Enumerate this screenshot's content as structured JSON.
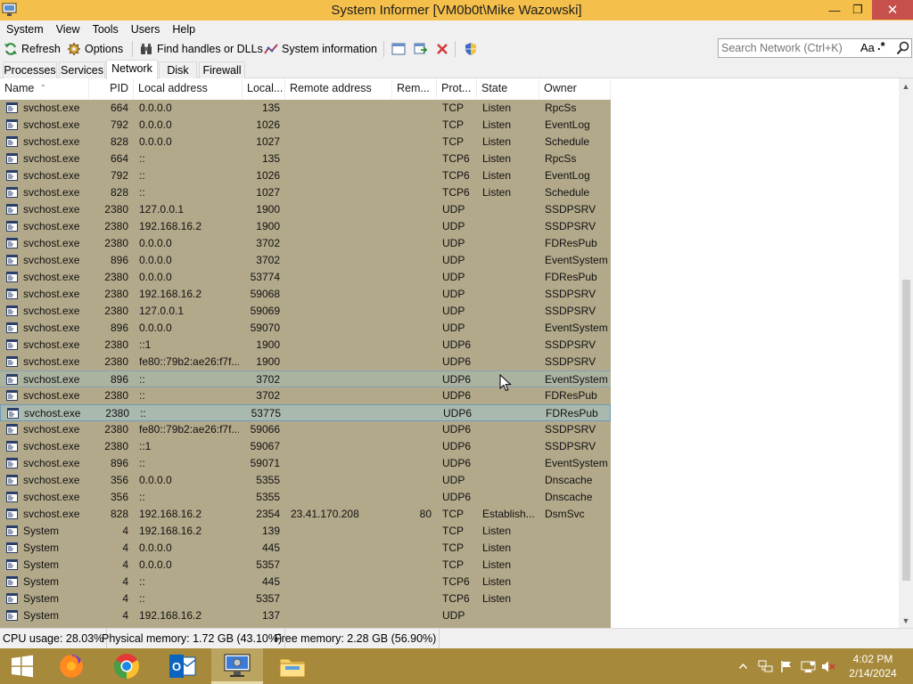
{
  "window": {
    "title": "System Informer [VM0b0t\\Mike Wazowski]",
    "min_icon": "minimize-icon",
    "max_icon": "restore-icon",
    "close_icon": "close-icon"
  },
  "menu": [
    "System",
    "View",
    "Tools",
    "Users",
    "Help"
  ],
  "toolbar": {
    "refresh": "Refresh",
    "options": "Options",
    "find_handles": "Find handles or DLLs",
    "system_information": "System information"
  },
  "search": {
    "placeholder": "Search Network (Ctrl+K)",
    "case_label": "Aa",
    "regex_label": ".*"
  },
  "tabs": [
    {
      "label": "Processes",
      "active": false
    },
    {
      "label": "Services",
      "active": false
    },
    {
      "label": "Network",
      "active": true
    },
    {
      "label": "Disk",
      "active": false
    },
    {
      "label": "Firewall",
      "active": false
    }
  ],
  "columns": [
    "Name",
    "PID",
    "Local address",
    "Local...",
    "Remote address",
    "Rem...",
    "Prot...",
    "State",
    "Owner"
  ],
  "rows": [
    {
      "name": "svchost.exe",
      "pid": "664",
      "local_address": "0.0.0.0",
      "local_port": "135",
      "remote_address": "",
      "remote_port": "",
      "protocol": "TCP",
      "state": "Listen",
      "owner": "RpcSs"
    },
    {
      "name": "svchost.exe",
      "pid": "792",
      "local_address": "0.0.0.0",
      "local_port": "1026",
      "remote_address": "",
      "remote_port": "",
      "protocol": "TCP",
      "state": "Listen",
      "owner": "EventLog"
    },
    {
      "name": "svchost.exe",
      "pid": "828",
      "local_address": "0.0.0.0",
      "local_port": "1027",
      "remote_address": "",
      "remote_port": "",
      "protocol": "TCP",
      "state": "Listen",
      "owner": "Schedule"
    },
    {
      "name": "svchost.exe",
      "pid": "664",
      "local_address": "::",
      "local_port": "135",
      "remote_address": "",
      "remote_port": "",
      "protocol": "TCP6",
      "state": "Listen",
      "owner": "RpcSs"
    },
    {
      "name": "svchost.exe",
      "pid": "792",
      "local_address": "::",
      "local_port": "1026",
      "remote_address": "",
      "remote_port": "",
      "protocol": "TCP6",
      "state": "Listen",
      "owner": "EventLog"
    },
    {
      "name": "svchost.exe",
      "pid": "828",
      "local_address": "::",
      "local_port": "1027",
      "remote_address": "",
      "remote_port": "",
      "protocol": "TCP6",
      "state": "Listen",
      "owner": "Schedule"
    },
    {
      "name": "svchost.exe",
      "pid": "2380",
      "local_address": "127.0.0.1",
      "local_port": "1900",
      "remote_address": "",
      "remote_port": "",
      "protocol": "UDP",
      "state": "",
      "owner": "SSDPSRV"
    },
    {
      "name": "svchost.exe",
      "pid": "2380",
      "local_address": "192.168.16.2",
      "local_port": "1900",
      "remote_address": "",
      "remote_port": "",
      "protocol": "UDP",
      "state": "",
      "owner": "SSDPSRV"
    },
    {
      "name": "svchost.exe",
      "pid": "2380",
      "local_address": "0.0.0.0",
      "local_port": "3702",
      "remote_address": "",
      "remote_port": "",
      "protocol": "UDP",
      "state": "",
      "owner": "FDResPub"
    },
    {
      "name": "svchost.exe",
      "pid": "896",
      "local_address": "0.0.0.0",
      "local_port": "3702",
      "remote_address": "",
      "remote_port": "",
      "protocol": "UDP",
      "state": "",
      "owner": "EventSystem"
    },
    {
      "name": "svchost.exe",
      "pid": "2380",
      "local_address": "0.0.0.0",
      "local_port": "53774",
      "remote_address": "",
      "remote_port": "",
      "protocol": "UDP",
      "state": "",
      "owner": "FDResPub"
    },
    {
      "name": "svchost.exe",
      "pid": "2380",
      "local_address": "192.168.16.2",
      "local_port": "59068",
      "remote_address": "",
      "remote_port": "",
      "protocol": "UDP",
      "state": "",
      "owner": "SSDPSRV"
    },
    {
      "name": "svchost.exe",
      "pid": "2380",
      "local_address": "127.0.0.1",
      "local_port": "59069",
      "remote_address": "",
      "remote_port": "",
      "protocol": "UDP",
      "state": "",
      "owner": "SSDPSRV"
    },
    {
      "name": "svchost.exe",
      "pid": "896",
      "local_address": "0.0.0.0",
      "local_port": "59070",
      "remote_address": "",
      "remote_port": "",
      "protocol": "UDP",
      "state": "",
      "owner": "EventSystem"
    },
    {
      "name": "svchost.exe",
      "pid": "2380",
      "local_address": "::1",
      "local_port": "1900",
      "remote_address": "",
      "remote_port": "",
      "protocol": "UDP6",
      "state": "",
      "owner": "SSDPSRV"
    },
    {
      "name": "svchost.exe",
      "pid": "2380",
      "local_address": "fe80::79b2:ae26:f7f...",
      "local_port": "1900",
      "remote_address": "",
      "remote_port": "",
      "protocol": "UDP6",
      "state": "",
      "owner": "SSDPSRV"
    },
    {
      "name": "svchost.exe",
      "pid": "896",
      "local_address": "::",
      "local_port": "3702",
      "remote_address": "",
      "remote_port": "",
      "protocol": "UDP6",
      "state": "",
      "owner": "EventSystem",
      "hover": true
    },
    {
      "name": "svchost.exe",
      "pid": "2380",
      "local_address": "::",
      "local_port": "3702",
      "remote_address": "",
      "remote_port": "",
      "protocol": "UDP6",
      "state": "",
      "owner": "FDResPub"
    },
    {
      "name": "svchost.exe",
      "pid": "2380",
      "local_address": "::",
      "local_port": "53775",
      "remote_address": "",
      "remote_port": "",
      "protocol": "UDP6",
      "state": "",
      "owner": "FDResPub",
      "selected": true
    },
    {
      "name": "svchost.exe",
      "pid": "2380",
      "local_address": "fe80::79b2:ae26:f7f...",
      "local_port": "59066",
      "remote_address": "",
      "remote_port": "",
      "protocol": "UDP6",
      "state": "",
      "owner": "SSDPSRV"
    },
    {
      "name": "svchost.exe",
      "pid": "2380",
      "local_address": "::1",
      "local_port": "59067",
      "remote_address": "",
      "remote_port": "",
      "protocol": "UDP6",
      "state": "",
      "owner": "SSDPSRV"
    },
    {
      "name": "svchost.exe",
      "pid": "896",
      "local_address": "::",
      "local_port": "59071",
      "remote_address": "",
      "remote_port": "",
      "protocol": "UDP6",
      "state": "",
      "owner": "EventSystem"
    },
    {
      "name": "svchost.exe",
      "pid": "356",
      "local_address": "0.0.0.0",
      "local_port": "5355",
      "remote_address": "",
      "remote_port": "",
      "protocol": "UDP",
      "state": "",
      "owner": "Dnscache"
    },
    {
      "name": "svchost.exe",
      "pid": "356",
      "local_address": "::",
      "local_port": "5355",
      "remote_address": "",
      "remote_port": "",
      "protocol": "UDP6",
      "state": "",
      "owner": "Dnscache"
    },
    {
      "name": "svchost.exe",
      "pid": "828",
      "local_address": "192.168.16.2",
      "local_port": "2354",
      "remote_address": "23.41.170.208",
      "remote_port": "80",
      "protocol": "TCP",
      "state": "Establish...",
      "owner": "DsmSvc"
    },
    {
      "name": "System",
      "pid": "4",
      "local_address": "192.168.16.2",
      "local_port": "139",
      "remote_address": "",
      "remote_port": "",
      "protocol": "TCP",
      "state": "Listen",
      "owner": ""
    },
    {
      "name": "System",
      "pid": "4",
      "local_address": "0.0.0.0",
      "local_port": "445",
      "remote_address": "",
      "remote_port": "",
      "protocol": "TCP",
      "state": "Listen",
      "owner": ""
    },
    {
      "name": "System",
      "pid": "4",
      "local_address": "0.0.0.0",
      "local_port": "5357",
      "remote_address": "",
      "remote_port": "",
      "protocol": "TCP",
      "state": "Listen",
      "owner": ""
    },
    {
      "name": "System",
      "pid": "4",
      "local_address": "::",
      "local_port": "445",
      "remote_address": "",
      "remote_port": "",
      "protocol": "TCP6",
      "state": "Listen",
      "owner": ""
    },
    {
      "name": "System",
      "pid": "4",
      "local_address": "::",
      "local_port": "5357",
      "remote_address": "",
      "remote_port": "",
      "protocol": "TCP6",
      "state": "Listen",
      "owner": ""
    },
    {
      "name": "System",
      "pid": "4",
      "local_address": "192.168.16.2",
      "local_port": "137",
      "remote_address": "",
      "remote_port": "",
      "protocol": "UDP",
      "state": "",
      "owner": ""
    }
  ],
  "status": {
    "cpu": "CPU usage: 28.03%",
    "physical": "Physical memory: 1.72 GB (43.10%)",
    "free": "Free memory: 2.28 GB (56.90%)"
  },
  "taskbar": {
    "apps": [
      "firefox-icon",
      "chrome-icon",
      "outlook-icon",
      "system-informer-icon",
      "file-explorer-icon"
    ],
    "tray": [
      "show-hidden-icons-chevron",
      "network-icon",
      "flag-icon",
      "action-center-icon",
      "volume-muted-icon"
    ],
    "time": "4:02 PM",
    "date": "2/14/2024"
  },
  "colors": {
    "title_bar": "#f4bf4a",
    "rows_bg": "#b2a88a",
    "taskbar": "#a6893a",
    "close_button": "#c7504c"
  }
}
